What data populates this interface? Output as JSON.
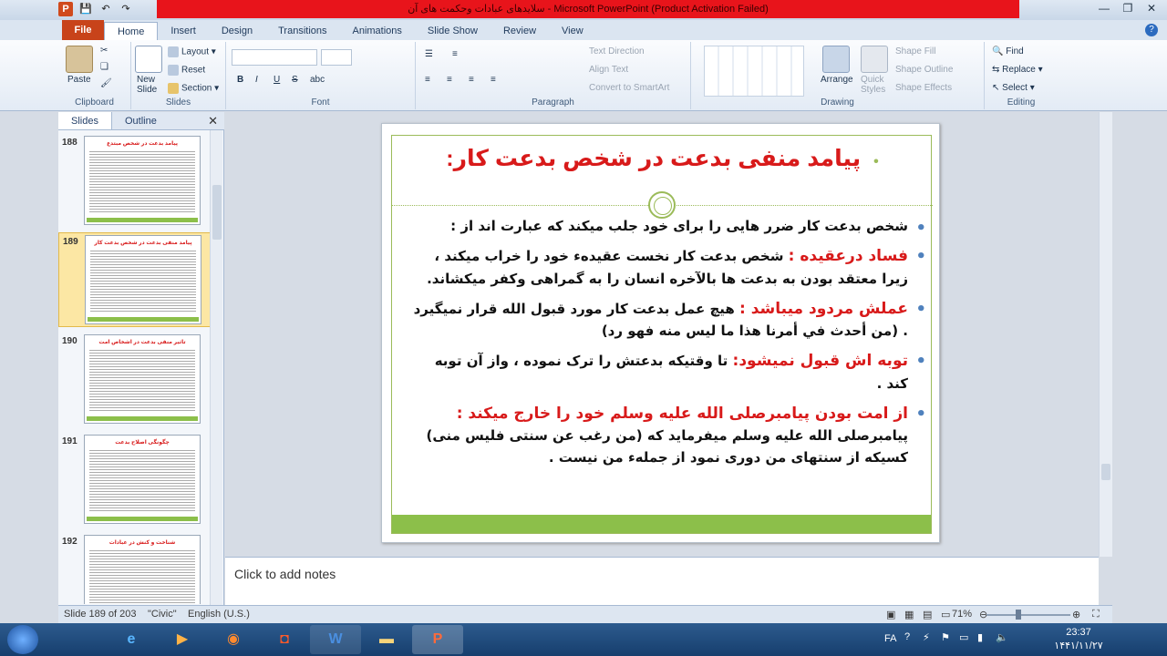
{
  "window": {
    "title": "سلایدهای عبادات وحکمت های آن - Microsoft PowerPoint (Product Activation Failed)"
  },
  "ribbon_tabs": [
    "File",
    "Home",
    "Insert",
    "Design",
    "Transitions",
    "Animations",
    "Slide Show",
    "Review",
    "View"
  ],
  "ribbon": {
    "clipboard": {
      "label": "Clipboard",
      "paste": "Paste"
    },
    "slides": {
      "label": "Slides",
      "new_slide": "New Slide",
      "layout": "Layout",
      "reset": "Reset",
      "section": "Section"
    },
    "font": {
      "label": "Font",
      "bold": "B",
      "italic": "I",
      "underline": "U",
      "strike": "S",
      "shadow": "abc"
    },
    "paragraph": {
      "label": "Paragraph",
      "text_direction": "Text Direction",
      "align_text": "Align Text",
      "smartart": "Convert to SmartArt"
    },
    "drawing": {
      "label": "Drawing",
      "arrange": "Arrange",
      "quick_styles": "Quick Styles",
      "shape_fill": "Shape Fill",
      "shape_outline": "Shape Outline",
      "shape_effects": "Shape Effects"
    },
    "editing": {
      "label": "Editing",
      "find": "Find",
      "replace": "Replace",
      "select": "Select"
    }
  },
  "panel": {
    "tabs": [
      "Slides",
      "Outline"
    ],
    "thumbnails": [
      {
        "num": "188",
        "title": "پیامد بدعت در شخص مبتدع"
      },
      {
        "num": "189",
        "title": "پیامد منفی بدعت در شخص بدعت کار"
      },
      {
        "num": "190",
        "title": "تاثیر منفی بدعت در اشخاص امت"
      },
      {
        "num": "191",
        "title": "چگونگی اصلاح بدعت"
      },
      {
        "num": "192",
        "title": "شناخت و کنش در عبادات"
      }
    ]
  },
  "slide": {
    "title": "پیامد منفی بدعت در شخص بدعت کار:",
    "bullets": [
      {
        "highlight": "",
        "text": "شخص بدعت کار ضرر هایی را برای خود جلب میکند که عبارت اند از :"
      },
      {
        "highlight": "فساد درعقیده :",
        "text": " شخص بدعت کار نخست عقیدهء خود را خراب میکند ، زیرا معتقد بودن به بدعت ها بالآخره انسان را به گمراهی وکفر میکشاند."
      },
      {
        "highlight": "عملش مردود میباشد :",
        "text": " هیچ عمل بدعت کار مورد قبول الله  قرار نمیگیرد . (من أحدث في أمرنا هذا ما ليس منه فهو رد)"
      },
      {
        "highlight": "توبه اش قبول نمیشود:",
        "text": " تا وقتیکه بدعتش را ترک نموده ، واز آن توبه کند ."
      },
      {
        "highlight": "از امت بودن پیامبرصلی الله علیه وسلم خود را خارج میکند :",
        "text": " پیامبرصلی الله علیه وسلم میفرماید که (من رغب عن سنتی فلیس منی) کسیکه از سنتهای من دوری نمود از جملهء من نیست ."
      }
    ]
  },
  "notes": {
    "placeholder": "Click to add notes"
  },
  "statusbar": {
    "slide_info": "Slide 189 of 203",
    "theme": "\"Civic\"",
    "language": "English (U.S.)",
    "zoom": "71%"
  },
  "taskbar": {
    "lang": "FA",
    "time": "23:37",
    "date": "۱۴۴۱/۱۱/۲۷"
  }
}
